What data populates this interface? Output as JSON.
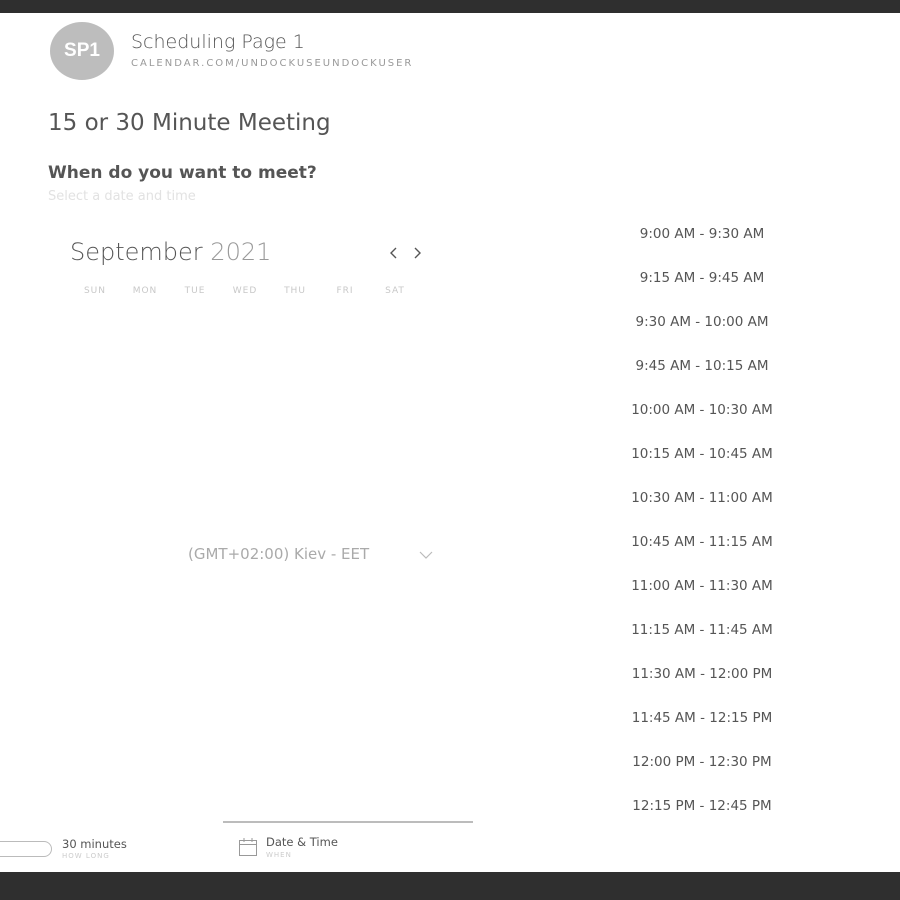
{
  "header": {
    "avatar_initials": "SP1",
    "page_name": "Scheduling Page 1",
    "page_url": "CALENDAR.COM/UNDOCKUSEUNDOCKUSER"
  },
  "meeting": {
    "title": "15 or 30 Minute Meeting",
    "question": "When do you want to meet?",
    "hint": "Select a date and time"
  },
  "calendar": {
    "month": "September",
    "year": "2021",
    "prev_icon": "chevron-left-icon",
    "next_icon": "chevron-right-icon",
    "weekdays": [
      "SUN",
      "MON",
      "TUE",
      "WED",
      "THU",
      "FRI",
      "SAT"
    ]
  },
  "timezone": {
    "value": "(GMT+02:00) Kiev - EET",
    "icon": "chevron-down-icon"
  },
  "time_slots": [
    "9:00 AM - 9:30 AM",
    "9:15 AM - 9:45 AM",
    "9:30 AM - 10:00 AM",
    "9:45 AM - 10:15 AM",
    "10:00 AM - 10:30 AM",
    "10:15 AM - 10:45 AM",
    "10:30 AM - 11:00 AM",
    "10:45 AM - 11:15 AM",
    "11:00 AM - 11:30 AM",
    "11:15 AM - 11:45 AM",
    "11:30 AM - 12:00 PM",
    "11:45 AM - 12:15 PM",
    "12:00 PM - 12:30 PM",
    "12:15 PM - 12:45 PM"
  ],
  "footer": {
    "duration_label": "30 minutes",
    "duration_sub": "HOW LONG",
    "step_label": "Date & Time",
    "step_sub": "WHEN",
    "step_icon": "calendar-icon"
  },
  "colors": {
    "frame": "#2f2f2f",
    "avatar_bg": "#bdbdbd",
    "text": "#555555",
    "muted": "#aaaaaa"
  }
}
